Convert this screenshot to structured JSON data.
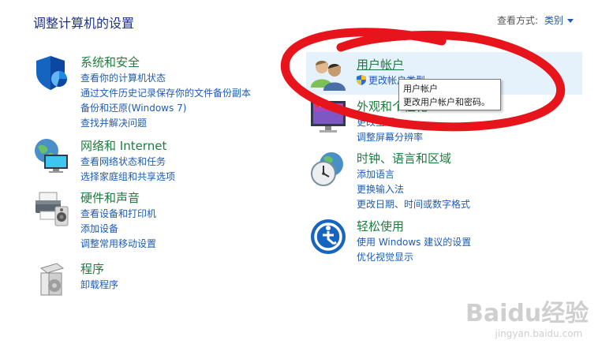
{
  "page": {
    "title": "调整计算机的设置"
  },
  "view_by": {
    "label": "查看方式:",
    "value": "类别"
  },
  "categories": {
    "system": {
      "title": "系统和安全",
      "links": [
        "查看你的计算机状态",
        "通过文件历史记录保存你的文件备份副本",
        "备份和还原(Windows 7)",
        "查找并解决问题"
      ]
    },
    "network": {
      "title": "网络和 Internet",
      "links": [
        "查看网络状态和任务",
        "选择家庭组和共享选项"
      ]
    },
    "hardware": {
      "title": "硬件和声音",
      "links": [
        "查看设备和打印机",
        "添加设备",
        "调整常用移动设置"
      ]
    },
    "programs": {
      "title": "程序",
      "links": [
        "卸载程序"
      ]
    },
    "user": {
      "title": "用户帐户",
      "links": [
        "更改帐户类型"
      ]
    },
    "appearance": {
      "title": "外观和个性化",
      "links": [
        "更改主题",
        "调整屏幕分辨率"
      ]
    },
    "clock": {
      "title": "时钟、语言和区域",
      "links": [
        "添加语言",
        "更换输入法",
        "更改日期、时间或数字格式"
      ]
    },
    "ease": {
      "title": "轻松使用",
      "links": [
        "使用 Windows 建议的设置",
        "优化视觉显示"
      ]
    }
  },
  "tooltip": {
    "line1": "用户帐户",
    "line2": "更改用户帐户和密码。"
  },
  "colors": {
    "heading_green": "#1e7b3e",
    "link_blue": "#1e5bb5",
    "title_blue": "#1e3287",
    "annotation_red": "#e8141b",
    "hover_bg": "#e5f1fb"
  },
  "watermark": {
    "brand": "Baidu经验",
    "url": "jingyan.baidu.com"
  }
}
